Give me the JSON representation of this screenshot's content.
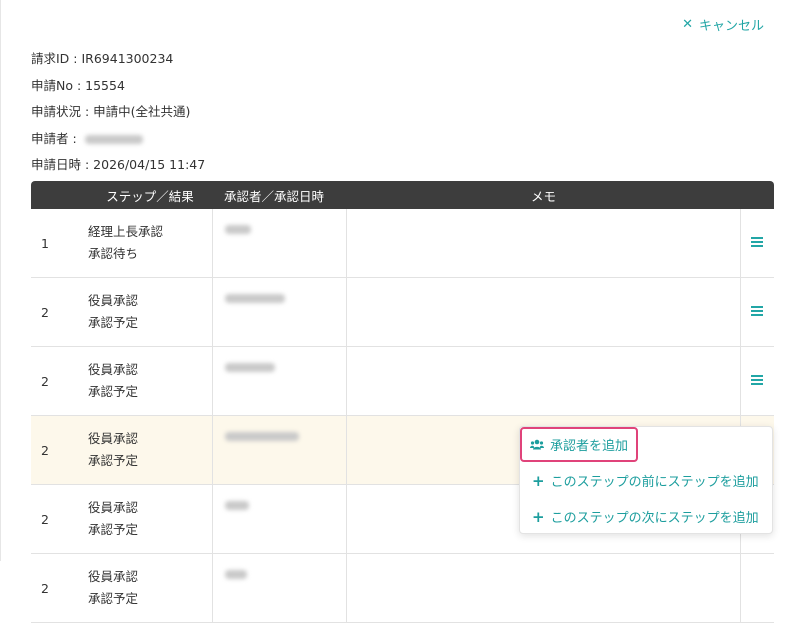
{
  "cancel": {
    "label": "キャンセル",
    "icon": "close-icon"
  },
  "info": {
    "request_id": "請求ID : IR6941300234",
    "application_no": "申請No : 15554",
    "status": "申請状況 : 申請中(全社共通)",
    "applicant_label": "申請者 :",
    "date": "申請日時 : 2026/04/15 11:47"
  },
  "table": {
    "headers": [
      "",
      "ステップ／結果",
      "承認者／承認日時",
      "メモ",
      ""
    ],
    "rows": [
      {
        "num": "1",
        "step": "経理上長承認",
        "result": "承認待ち"
      },
      {
        "num": "2",
        "step": "役員承認",
        "result": "承認予定"
      },
      {
        "num": "2",
        "step": "役員承認",
        "result": "承認予定"
      },
      {
        "num": "2",
        "step": "役員承認",
        "result": "承認予定"
      },
      {
        "num": "2",
        "step": "役員承認",
        "result": "承認予定"
      },
      {
        "num": "2",
        "step": "役員承認",
        "result": "承認予定"
      }
    ]
  },
  "menu": {
    "add_approver": "承認者を追加",
    "add_step_before": "このステップの前にステップを追加",
    "add_step_after": "このステップの次にステップを追加"
  },
  "colors": {
    "accent": "#22a6a6",
    "highlight_border": "#e0437a",
    "header_bg": "#3d3d3d",
    "highlight_row": "#fdf8eb"
  }
}
